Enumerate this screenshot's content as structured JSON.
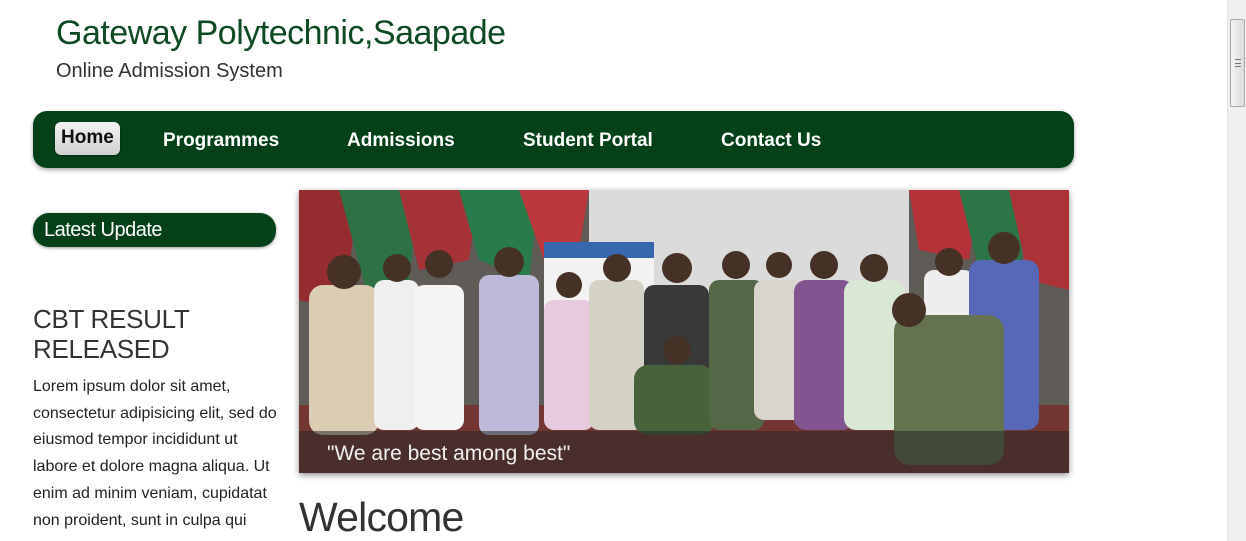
{
  "header": {
    "title": "Gateway Polytechnic,Saapade",
    "subtitle": "Online Admission System"
  },
  "nav": {
    "items": [
      {
        "label": "Home",
        "active": true
      },
      {
        "label": "Programmes",
        "active": false
      },
      {
        "label": "Admissions",
        "active": false
      },
      {
        "label": "Student Portal",
        "active": false
      },
      {
        "label": "Contact Us",
        "active": false
      }
    ]
  },
  "sidebar": {
    "header": "Latest Update",
    "news_title": "CBT RESULT RELEASED",
    "news_body": "Lorem ipsum dolor sit amet, consectetur adipisicing elit, sed do eiusmod tempor incididunt ut labore et dolore magna aliqua. Ut enim ad minim veniam, cupidatat non proident, sunt in culpa qui"
  },
  "banner": {
    "caption": "\"We are best among best\""
  },
  "main": {
    "heading": "Welcome"
  },
  "colors": {
    "brand_green": "#054118",
    "title_green": "#0e4a23"
  }
}
